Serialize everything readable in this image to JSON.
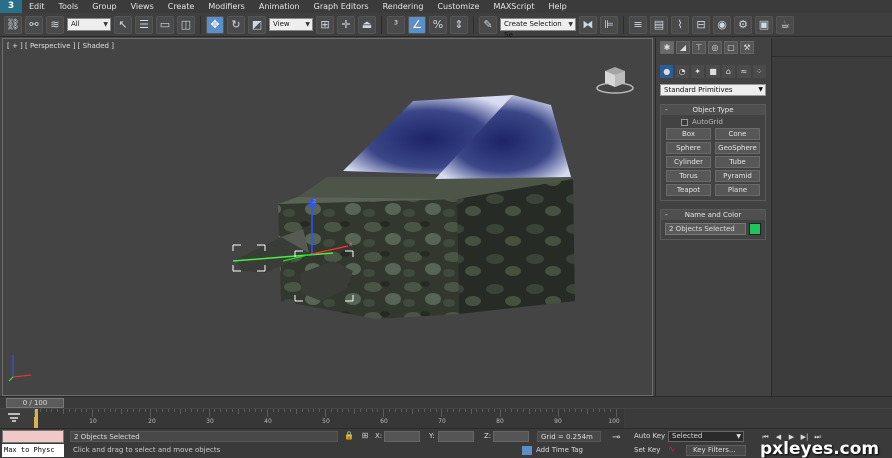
{
  "app": {
    "logo": "3"
  },
  "menu": [
    "Edit",
    "Tools",
    "Group",
    "Views",
    "Create",
    "Modifiers",
    "Animation",
    "Graph Editors",
    "Rendering",
    "Customize",
    "MAXScript",
    "Help"
  ],
  "toolbar": {
    "filter_value": "All",
    "coord_system": "View",
    "selection_set_placeholder": "Create Selection Se"
  },
  "viewport": {
    "label": "[ + ] [ Perspective ] [ Shaded ]"
  },
  "command_panel": {
    "category": "Standard Primitives",
    "object_type": {
      "title": "Object Type",
      "autogrid_label": "AutoGrid",
      "primitives": [
        "Box",
        "Cone",
        "Sphere",
        "GeoSphere",
        "Cylinder",
        "Tube",
        "Torus",
        "Pyramid",
        "Teapot",
        "Plane"
      ]
    },
    "name_and_color": {
      "title": "Name and Color",
      "name_value": "2 Objects Selected",
      "color": "#1fc45a"
    }
  },
  "timeline": {
    "slider_label": "0 / 100",
    "ticks": [
      "10",
      "20",
      "30",
      "40",
      "50",
      "60",
      "70",
      "80",
      "90",
      "100"
    ]
  },
  "status": {
    "maxscript_listener": "Max to Physc",
    "selection": "2 Objects Selected",
    "prompt": "Click and drag to select and move objects",
    "x_label": "X:",
    "y_label": "Y:",
    "z_label": "Z:",
    "grid": "Grid = 0.254m",
    "add_time_tag": "Add Time Tag",
    "auto_key": "Auto Key",
    "set_key": "Set Key",
    "key_mode": "Selected",
    "key_filters": "Key Filters..."
  },
  "watermark": "pxleyes.com"
}
